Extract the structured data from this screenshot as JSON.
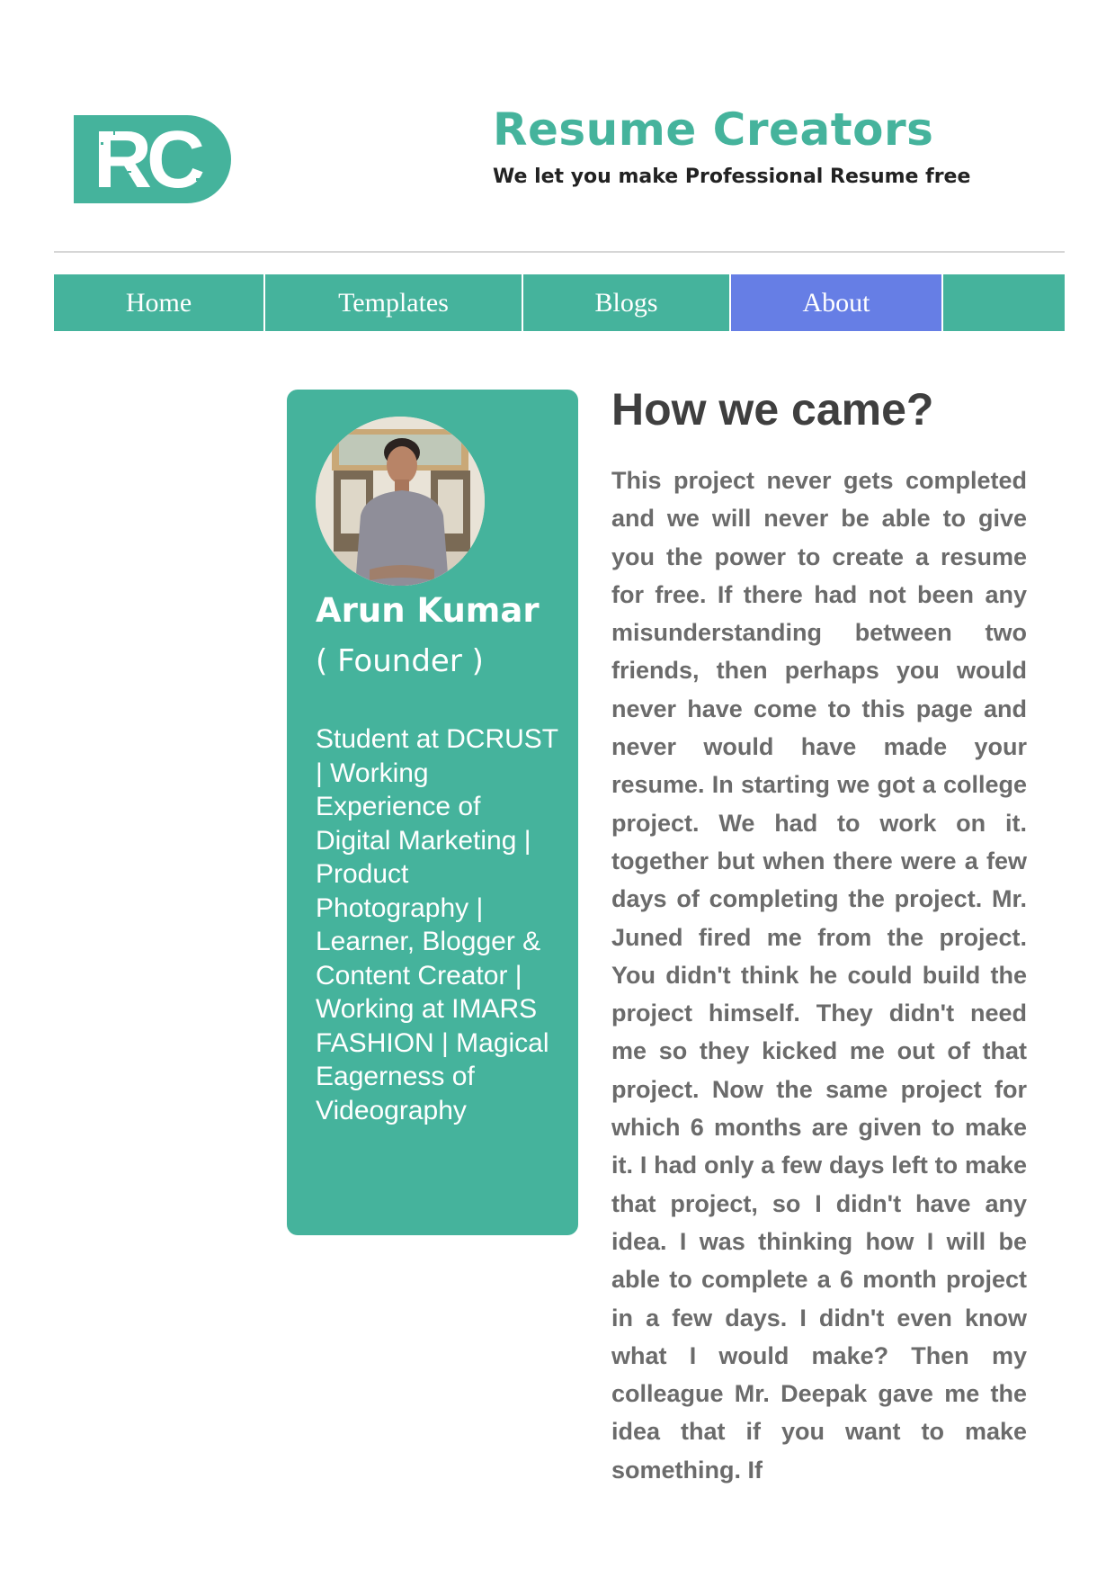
{
  "header": {
    "logo_text": "RC",
    "title": "Resume Creators",
    "tagline": "We let you make Professional Resume free"
  },
  "nav": {
    "items": [
      {
        "label": "Home"
      },
      {
        "label": "Templates"
      },
      {
        "label": "Blogs"
      },
      {
        "label": "About"
      },
      {
        "label": ""
      }
    ],
    "active": "About"
  },
  "profile": {
    "avatar_icon": "founder-photo",
    "name": "Arun Kumar",
    "role": "( Founder )",
    "bio": "Student at DCRUST | Working Experience of Digital Marketing | Product Photography | Learner, Blogger & Content Creator | Working at IMARS FASHION | Magical Eagerness of Videography"
  },
  "main": {
    "heading": "How we came?",
    "body": "This project never gets completed and we will never be able to give you the power to create a resume for free. If there had not been any misunderstanding between two friends, then perhaps you would never have come to this page and never would have made your resume. In starting we got a college project. We had to work on it. together but when there were a few days of completing the project. Mr. Juned fired me from the project. You didn't think he could build the project himself. They didn't need me so they kicked me out of that project. Now the same project for which 6 months are given to make it. I had only a few days left to make that project, so I didn't have any idea. I was thinking how I will be able to complete a 6 month project in a few days. I didn't even know what I would make? Then my colleague Mr. Deepak gave me the idea that if you want to make something. If"
  },
  "colors": {
    "brand": "#45b39c",
    "active_nav": "#667ee5",
    "heading": "#3f3f3f",
    "body_text": "#6b6b6b"
  }
}
